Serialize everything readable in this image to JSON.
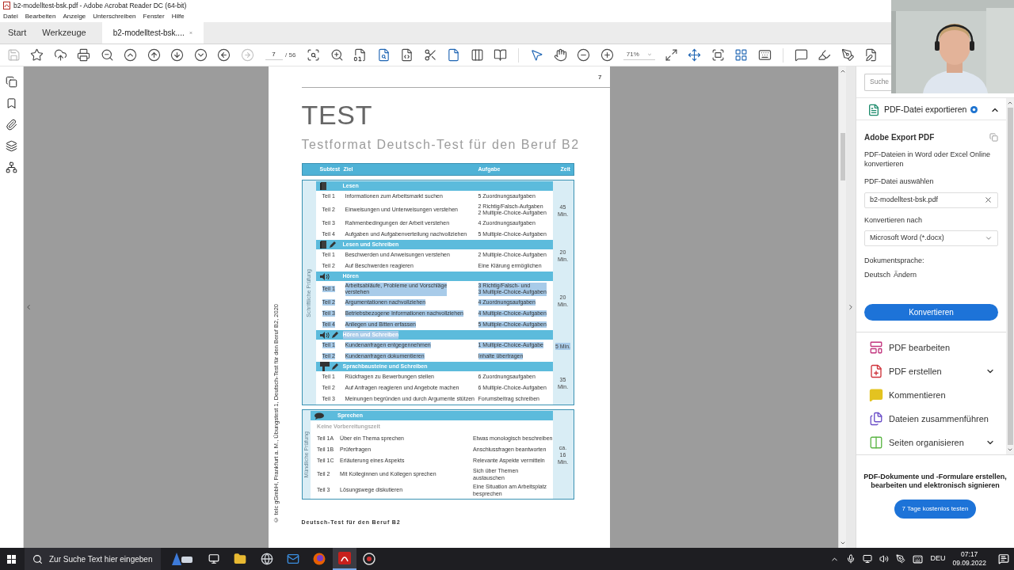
{
  "window": {
    "title": "b2-modelltest-bsk.pdf - Adobe Acrobat Reader DC (64-bit)"
  },
  "menu": [
    "Datei",
    "Bearbeiten",
    "Anzeige",
    "Unterschreiben",
    "Fenster",
    "Hilfe"
  ],
  "tabs": [
    {
      "label": "Start",
      "selected": false
    },
    {
      "label": "Werkzeuge",
      "selected": false
    },
    {
      "label": "b2-modelltest-bsk....",
      "selected": true
    }
  ],
  "toolbar": {
    "page": "7",
    "page_count": "/ 56",
    "zoom": "71%"
  },
  "document": {
    "page_number": "7",
    "title": "TEST",
    "subtitle": "Testformat Deutsch-Test für den Beruf B2",
    "columns": [
      "Subtest",
      "Ziel",
      "Aufgabe",
      "Zeit"
    ],
    "blocks": [
      {
        "label": "Schriftliche Prüfung",
        "sections": [
          {
            "icons": [
              {
                "kind": "book"
              }
            ],
            "title": "Lesen",
            "highlighted": false,
            "zeit": {
              "lines": [
                "45",
                "Min."
              ],
              "highlighted": false
            },
            "rows": [
              {
                "teil": "Teil 1",
                "ziel": [
                  "Informationen zum Arbeitsmarkt suchen"
                ],
                "aufgabe": [
                  "5 Zuordnungsaufgaben"
                ],
                "highlighted": false
              },
              {
                "teil": "Teil 2",
                "ziel": [
                  "Einweisungen und Unterweisungen verstehen"
                ],
                "aufgabe": [
                  "2 Richtig/Falsch-Aufgaben",
                  "2 Multiple-Choice-Aufgaben"
                ],
                "highlighted": false
              },
              {
                "teil": "Teil 3",
                "ziel": [
                  "Rahmenbedingungen der Arbeit verstehen"
                ],
                "aufgabe": [
                  "4 Zuordnungsaufgaben"
                ],
                "highlighted": false
              },
              {
                "teil": "Teil 4",
                "ziel": [
                  "Aufgaben und Aufgabenverteilung nachvollziehen"
                ],
                "aufgabe": [
                  "5 Multiple-Choice-Aufgaben"
                ],
                "highlighted": false
              }
            ]
          },
          {
            "icons": [
              {
                "kind": "book"
              },
              {
                "kind": "pencil"
              }
            ],
            "title": "Lesen und Schreiben",
            "highlighted": false,
            "zeit": {
              "lines": [
                "20",
                "Min."
              ],
              "highlighted": false
            },
            "rows": [
              {
                "teil": "Teil 1",
                "ziel": [
                  "Beschwerden und Anweisungen verstehen"
                ],
                "aufgabe": [
                  "2 Multiple-Choice-Aufgaben"
                ],
                "highlighted": false
              },
              {
                "teil": "Teil 2",
                "ziel": [
                  "Auf Beschwerden reagieren"
                ],
                "aufgabe": [
                  "Eine Klärung ermöglichen"
                ],
                "highlighted": false
              }
            ]
          },
          {
            "icons": [
              {
                "kind": "speaker"
              }
            ],
            "title": "Hören",
            "highlighted": false,
            "zeit": {
              "lines": [
                "20",
                "Min."
              ],
              "highlighted": false
            },
            "rows": [
              {
                "teil": "Teil 1",
                "ziel": [
                  "Arbeitsabläufe, Probleme und Vorschläge",
                  "verstehen"
                ],
                "aufgabe": [
                  "3 Richtig/Falsch- und",
                  "3 Multiple-Choice-Aufgaben"
                ],
                "highlighted": true
              },
              {
                "teil": "Teil 2",
                "ziel": [
                  "Argumentationen nachvollziehen"
                ],
                "aufgabe": [
                  "4 Zuordnungsaufgaben"
                ],
                "highlighted": true
              },
              {
                "teil": "Teil 3",
                "ziel": [
                  "Betriebsbezogene Informationen nachvollziehen"
                ],
                "aufgabe": [
                  "4 Multiple-Choice-Aufgaben"
                ],
                "highlighted": true
              },
              {
                "teil": "Teil 4",
                "ziel": [
                  "Anliegen und Bitten erfassen"
                ],
                "aufgabe": [
                  "5 Multiple-Choice-Aufgaben"
                ],
                "highlighted": true
              }
            ]
          },
          {
            "icons": [
              {
                "kind": "speaker"
              },
              {
                "kind": "pencil"
              }
            ],
            "title": "Hören und Schreiben",
            "highlighted": true,
            "zeit": {
              "lines": [
                "5 Min."
              ],
              "highlighted": true
            },
            "rows": [
              {
                "teil": "Teil 1",
                "ziel": [
                  "Kundenanfragen entgegennehmen"
                ],
                "aufgabe": [
                  "1 Multiple-Choice-Aufgabe"
                ],
                "highlighted": true
              },
              {
                "teil": "Teil 2",
                "ziel": [
                  "Kundenanfragen dokumentieren"
                ],
                "aufgabe": [
                  "Inhalte übertragen"
                ],
                "highlighted": true
              }
            ]
          },
          {
            "icons": [
              {
                "kind": "puzzle"
              },
              {
                "kind": "pencil"
              }
            ],
            "title": "Sprachbausteine und Schreiben",
            "highlighted": false,
            "zeit": {
              "lines": [
                "35",
                "Min."
              ],
              "highlighted": false
            },
            "rows": [
              {
                "teil": "Teil 1",
                "ziel": [
                  "Rückfragen zu Bewerbungen stellen"
                ],
                "aufgabe": [
                  "6 Zuordnungsaufgaben"
                ],
                "highlighted": false
              },
              {
                "teil": "Teil 2",
                "ziel": [
                  "Auf Anfragen reagieren und Angebote machen"
                ],
                "aufgabe": [
                  "6 Multiple-Choice-Aufgaben"
                ],
                "highlighted": false
              },
              {
                "teil": "Teil 3",
                "ziel": [
                  "Meinungen begründen und durch Argumente stützen"
                ],
                "aufgabe": [
                  "Forumsbeitrag schreiben"
                ],
                "highlighted": false
              }
            ]
          }
        ]
      },
      {
        "label": "Mündliche Prüfung",
        "sections": [
          {
            "icons": [
              {
                "kind": "speech"
              }
            ],
            "title": "Sprechen",
            "highlighted": false,
            "note": "Keine Vorbereitungszeit",
            "zeit": {
              "lines": [
                "ca.",
                "16",
                "Min."
              ],
              "highlighted": false
            },
            "rows": [
              {
                "teil": "Teil 1A",
                "ziel": [
                  "Über ein Thema sprechen"
                ],
                "aufgabe": [
                  "Etwas monologisch beschreiben"
                ],
                "highlighted": false
              },
              {
                "teil": "Teil 1B",
                "ziel": [
                  "Prüferfragen"
                ],
                "aufgabe": [
                  "Anschlussfragen beantworten"
                ],
                "highlighted": false
              },
              {
                "teil": "Teil 1C",
                "ziel": [
                  "Erläuterung eines Aspekts"
                ],
                "aufgabe": [
                  "Relevante Aspekte vermitteln"
                ],
                "highlighted": false
              },
              {
                "teil": "Teil 2",
                "ziel": [
                  "Mit Kolleginnen und Kollegen sprechen"
                ],
                "aufgabe": [
                  "Sich über Themen",
                  "austauschen"
                ],
                "highlighted": false
              },
              {
                "teil": "Teil 3",
                "ziel": [
                  "Lösungswege diskutieren"
                ],
                "aufgabe": [
                  "Eine Situation am Arbeitsplatz",
                  "besprechen"
                ],
                "highlighted": false
              }
            ]
          }
        ]
      }
    ],
    "side_note": "© telc gGmbH, Frankfurt a. M., Übungstest 1, Deutsch-Test für den Beruf B2, 2020",
    "footer": "Deutsch-Test für den Beruf B2"
  },
  "panel": {
    "search_placeholder": "Suche",
    "export": {
      "title": "PDF-Datei exportieren",
      "expanded": true,
      "heading": "Adobe Export PDF",
      "description": "PDF-Dateien in Word oder Excel Online konvertieren",
      "file_label": "PDF-Datei auswählen",
      "file_value": "b2-modelltest-bsk.pdf",
      "convert_label": "Konvertieren nach",
      "convert_value": "Microsoft Word (*.docx)",
      "language_label": "Dokumentsprache:",
      "language": "Deutsch",
      "change_link": "Ändern",
      "button": "Konvertieren"
    },
    "tools": [
      {
        "kind": "edit",
        "label": "PDF bearbeiten",
        "color": "#c2357e",
        "expandable": false
      },
      {
        "kind": "create",
        "label": "PDF erstellen",
        "color": "#d0343c",
        "expandable": true
      },
      {
        "kind": "comment",
        "label": "Kommentieren",
        "color": "#e3c320",
        "expandable": false
      },
      {
        "kind": "combine",
        "label": "Dateien zusammenführen",
        "color": "#6b4fc8",
        "expandable": false
      },
      {
        "kind": "organize",
        "label": "Seiten organisieren",
        "color": "#5cb646",
        "expandable": true
      }
    ],
    "promo": "PDF-Dokumente und -Formulare erstellen, bearbeiten und elektronisch signieren",
    "promo_button": "7 Tage kostenlos testen"
  },
  "taskbar": {
    "search_placeholder": "Zur Suche Text hier eingeben",
    "language": "DEU",
    "time": "07:17",
    "date": "09.09.2022"
  }
}
